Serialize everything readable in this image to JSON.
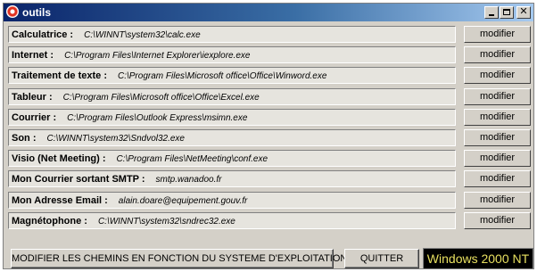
{
  "window": {
    "title": "outils",
    "icon": "app-icon",
    "controls": [
      "minimize-icon",
      "maximize-icon",
      "close-icon"
    ]
  },
  "tools": [
    {
      "label": "Calculatrice :",
      "path": "C:\\WINNT\\system32\\calc.exe",
      "button": "modifier"
    },
    {
      "label": "Internet :",
      "path": "C:\\Program Files\\Internet Explorer\\iexplore.exe",
      "button": "modifier"
    },
    {
      "label": "Traitement de texte :",
      "path": "C:\\Program Files\\Microsoft office\\Office\\Winword.exe",
      "button": "modifier"
    },
    {
      "label": "Tableur :",
      "path": "C:\\Program Files\\Microsoft office\\Office\\Excel.exe",
      "button": "modifier"
    },
    {
      "label": "Courrier :",
      "path": "C:\\Program Files\\Outlook Express\\msimn.exe",
      "button": "modifier"
    },
    {
      "label": "Son :",
      "path": "C:\\WINNT\\system32\\Sndvol32.exe",
      "button": "modifier"
    },
    {
      "label": "Visio (Net Meeting) :",
      "path": "C:\\Program Files\\NetMeeting\\conf.exe",
      "button": "modifier"
    },
    {
      "label": "Mon Courrier sortant SMTP :",
      "path": "smtp.wanadoo.fr",
      "button": "modifier"
    },
    {
      "label": "Mon Adresse Email :",
      "path": "alain.doare@equipement.gouv.fr",
      "button": "modifier"
    },
    {
      "label": "Magnétophone :",
      "path": "C:\\WINNT\\system32\\sndrec32.exe",
      "button": "modifier"
    }
  ],
  "bottom": {
    "modify_paths_label": "MODIFIER LES CHEMINS EN FONCTION DU SYSTEME D'EXPLOITATION",
    "quit_label": "QUITTER",
    "os_label": "Windows 2000 NT"
  },
  "colors": {
    "title_bar": "#0a246a",
    "face": "#d4d0c8",
    "os_box_bg": "#000000",
    "os_box_text": "#e8e060"
  }
}
